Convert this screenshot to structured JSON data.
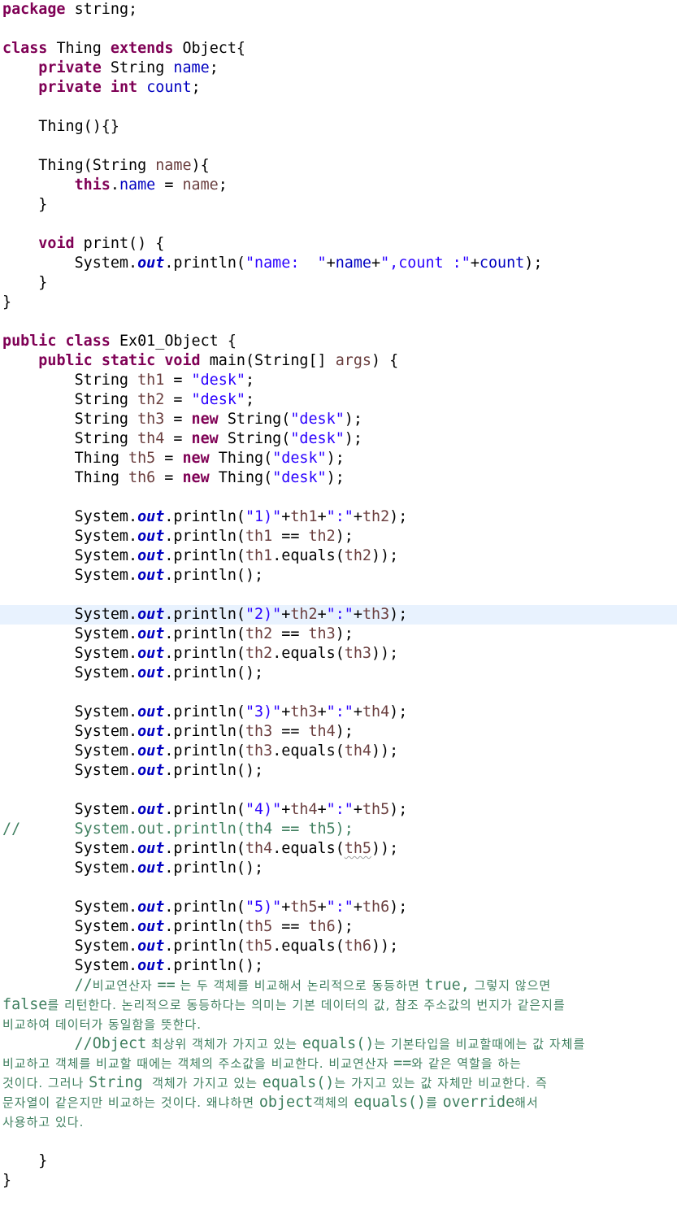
{
  "editor": {
    "highlighted_line_index": 31,
    "colors": {
      "keyword": "#7f0055",
      "string": "#2a00ff",
      "field": "#0000c0",
      "variable": "#6a3e3e",
      "comment": "#3f7f5f",
      "line_highlight": "#e8f2fe"
    },
    "lines": [
      [
        {
          "t": "package",
          "c": "kw"
        },
        {
          "t": " string;"
        }
      ],
      [],
      [
        {
          "t": "class",
          "c": "kw"
        },
        {
          "t": " Thing "
        },
        {
          "t": "extends",
          "c": "kw"
        },
        {
          "t": " Object{"
        }
      ],
      [
        {
          "t": "    "
        },
        {
          "t": "private",
          "c": "kw"
        },
        {
          "t": " String "
        },
        {
          "t": "name",
          "c": "fld"
        },
        {
          "t": ";"
        }
      ],
      [
        {
          "t": "    "
        },
        {
          "t": "private",
          "c": "kw"
        },
        {
          "t": " "
        },
        {
          "t": "int",
          "c": "kw"
        },
        {
          "t": " "
        },
        {
          "t": "count",
          "c": "fld"
        },
        {
          "t": ";"
        }
      ],
      [],
      [
        {
          "t": "    Thing(){}"
        }
      ],
      [],
      [
        {
          "t": "    Thing(String "
        },
        {
          "t": "name",
          "c": "var"
        },
        {
          "t": "){"
        }
      ],
      [
        {
          "t": "        "
        },
        {
          "t": "this",
          "c": "kw"
        },
        {
          "t": "."
        },
        {
          "t": "name",
          "c": "fld"
        },
        {
          "t": " = "
        },
        {
          "t": "name",
          "c": "var"
        },
        {
          "t": ";"
        }
      ],
      [
        {
          "t": "    }"
        }
      ],
      [],
      [
        {
          "t": "    "
        },
        {
          "t": "void",
          "c": "kw"
        },
        {
          "t": " print() {"
        }
      ],
      [
        {
          "t": "        System."
        },
        {
          "t": "out",
          "c": "sfld"
        },
        {
          "t": ".println("
        },
        {
          "t": "\"name:  \"",
          "c": "str"
        },
        {
          "t": "+"
        },
        {
          "t": "name",
          "c": "fld"
        },
        {
          "t": "+"
        },
        {
          "t": "\",count :\"",
          "c": "str"
        },
        {
          "t": "+"
        },
        {
          "t": "count",
          "c": "fld"
        },
        {
          "t": ");"
        }
      ],
      [
        {
          "t": "    }"
        }
      ],
      [
        {
          "t": "}"
        }
      ],
      [],
      [
        {
          "t": "public",
          "c": "kw"
        },
        {
          "t": " "
        },
        {
          "t": "class",
          "c": "kw"
        },
        {
          "t": " Ex01_Object {"
        }
      ],
      [
        {
          "t": "    "
        },
        {
          "t": "public",
          "c": "kw"
        },
        {
          "t": " "
        },
        {
          "t": "static",
          "c": "kw"
        },
        {
          "t": " "
        },
        {
          "t": "void",
          "c": "kw"
        },
        {
          "t": " main(String[] "
        },
        {
          "t": "args",
          "c": "var"
        },
        {
          "t": ") {"
        }
      ],
      [
        {
          "t": "        String "
        },
        {
          "t": "th1",
          "c": "var"
        },
        {
          "t": " = "
        },
        {
          "t": "\"desk\"",
          "c": "str"
        },
        {
          "t": ";"
        }
      ],
      [
        {
          "t": "        String "
        },
        {
          "t": "th2",
          "c": "var"
        },
        {
          "t": " = "
        },
        {
          "t": "\"desk\"",
          "c": "str"
        },
        {
          "t": ";"
        }
      ],
      [
        {
          "t": "        String "
        },
        {
          "t": "th3",
          "c": "var"
        },
        {
          "t": " = "
        },
        {
          "t": "new",
          "c": "kw"
        },
        {
          "t": " String("
        },
        {
          "t": "\"desk\"",
          "c": "str"
        },
        {
          "t": ");"
        }
      ],
      [
        {
          "t": "        String "
        },
        {
          "t": "th4",
          "c": "var"
        },
        {
          "t": " = "
        },
        {
          "t": "new",
          "c": "kw"
        },
        {
          "t": " String("
        },
        {
          "t": "\"desk\"",
          "c": "str"
        },
        {
          "t": ");"
        }
      ],
      [
        {
          "t": "        Thing "
        },
        {
          "t": "th5",
          "c": "var"
        },
        {
          "t": " = "
        },
        {
          "t": "new",
          "c": "kw"
        },
        {
          "t": " Thing("
        },
        {
          "t": "\"desk\"",
          "c": "str"
        },
        {
          "t": ");"
        }
      ],
      [
        {
          "t": "        Thing "
        },
        {
          "t": "th6",
          "c": "var"
        },
        {
          "t": " = "
        },
        {
          "t": "new",
          "c": "kw"
        },
        {
          "t": " Thing("
        },
        {
          "t": "\"desk\"",
          "c": "str"
        },
        {
          "t": ");"
        }
      ],
      [],
      [
        {
          "t": "        System."
        },
        {
          "t": "out",
          "c": "sfld"
        },
        {
          "t": ".println("
        },
        {
          "t": "\"1)\"",
          "c": "str"
        },
        {
          "t": "+"
        },
        {
          "t": "th1",
          "c": "var"
        },
        {
          "t": "+"
        },
        {
          "t": "\":\"",
          "c": "str"
        },
        {
          "t": "+"
        },
        {
          "t": "th2",
          "c": "var"
        },
        {
          "t": ");"
        }
      ],
      [
        {
          "t": "        System."
        },
        {
          "t": "out",
          "c": "sfld"
        },
        {
          "t": ".println("
        },
        {
          "t": "th1",
          "c": "var"
        },
        {
          "t": " == "
        },
        {
          "t": "th2",
          "c": "var"
        },
        {
          "t": ");"
        }
      ],
      [
        {
          "t": "        System."
        },
        {
          "t": "out",
          "c": "sfld"
        },
        {
          "t": ".println("
        },
        {
          "t": "th1",
          "c": "var"
        },
        {
          "t": ".equals("
        },
        {
          "t": "th2",
          "c": "var"
        },
        {
          "t": "));"
        }
      ],
      [
        {
          "t": "        System."
        },
        {
          "t": "out",
          "c": "sfld"
        },
        {
          "t": ".println();"
        }
      ],
      [],
      [
        {
          "t": "        System."
        },
        {
          "t": "out",
          "c": "sfld"
        },
        {
          "t": ".println("
        },
        {
          "t": "\"2)\"",
          "c": "str"
        },
        {
          "t": "+"
        },
        {
          "t": "th2",
          "c": "var"
        },
        {
          "t": "+"
        },
        {
          "t": "\":\"",
          "c": "str"
        },
        {
          "t": "+"
        },
        {
          "t": "th3",
          "c": "var"
        },
        {
          "t": ");"
        }
      ],
      [
        {
          "t": "        System."
        },
        {
          "t": "out",
          "c": "sfld"
        },
        {
          "t": ".println("
        },
        {
          "t": "th2",
          "c": "var"
        },
        {
          "t": " == "
        },
        {
          "t": "th3",
          "c": "var"
        },
        {
          "t": ");"
        }
      ],
      [
        {
          "t": "        System."
        },
        {
          "t": "out",
          "c": "sfld"
        },
        {
          "t": ".println("
        },
        {
          "t": "th2",
          "c": "var"
        },
        {
          "t": ".equals("
        },
        {
          "t": "th3",
          "c": "var"
        },
        {
          "t": "));"
        }
      ],
      [
        {
          "t": "        System."
        },
        {
          "t": "out",
          "c": "sfld"
        },
        {
          "t": ".println();"
        }
      ],
      [],
      [
        {
          "t": "        System."
        },
        {
          "t": "out",
          "c": "sfld"
        },
        {
          "t": ".println("
        },
        {
          "t": "\"3)\"",
          "c": "str"
        },
        {
          "t": "+"
        },
        {
          "t": "th3",
          "c": "var"
        },
        {
          "t": "+"
        },
        {
          "t": "\":\"",
          "c": "str"
        },
        {
          "t": "+"
        },
        {
          "t": "th4",
          "c": "var"
        },
        {
          "t": ");"
        }
      ],
      [
        {
          "t": "        System."
        },
        {
          "t": "out",
          "c": "sfld"
        },
        {
          "t": ".println("
        },
        {
          "t": "th3",
          "c": "var"
        },
        {
          "t": " == "
        },
        {
          "t": "th4",
          "c": "var"
        },
        {
          "t": ");"
        }
      ],
      [
        {
          "t": "        System."
        },
        {
          "t": "out",
          "c": "sfld"
        },
        {
          "t": ".println("
        },
        {
          "t": "th3",
          "c": "var"
        },
        {
          "t": ".equals("
        },
        {
          "t": "th4",
          "c": "var"
        },
        {
          "t": "));"
        }
      ],
      [
        {
          "t": "        System."
        },
        {
          "t": "out",
          "c": "sfld"
        },
        {
          "t": ".println();"
        }
      ],
      [],
      [
        {
          "t": "        System."
        },
        {
          "t": "out",
          "c": "sfld"
        },
        {
          "t": ".println("
        },
        {
          "t": "\"4)\"",
          "c": "str"
        },
        {
          "t": "+"
        },
        {
          "t": "th4",
          "c": "var"
        },
        {
          "t": "+"
        },
        {
          "t": "\":\"",
          "c": "str"
        },
        {
          "t": "+"
        },
        {
          "t": "th5",
          "c": "var"
        },
        {
          "t": ");"
        }
      ],
      [
        {
          "t": "//      System.out.println(th4 == th5);",
          "c": "cmt"
        }
      ],
      [
        {
          "t": "        System."
        },
        {
          "t": "out",
          "c": "sfld"
        },
        {
          "t": ".println("
        },
        {
          "t": "th4",
          "c": "var"
        },
        {
          "t": ".equals("
        },
        {
          "t": "th5",
          "c": "var squig"
        },
        {
          "t": "));"
        }
      ],
      [
        {
          "t": "        System."
        },
        {
          "t": "out",
          "c": "sfld"
        },
        {
          "t": ".println();"
        }
      ],
      [],
      [
        {
          "t": "        System."
        },
        {
          "t": "out",
          "c": "sfld"
        },
        {
          "t": ".println("
        },
        {
          "t": "\"5)\"",
          "c": "str"
        },
        {
          "t": "+"
        },
        {
          "t": "th5",
          "c": "var"
        },
        {
          "t": "+"
        },
        {
          "t": "\":\"",
          "c": "str"
        },
        {
          "t": "+"
        },
        {
          "t": "th6",
          "c": "var"
        },
        {
          "t": ");"
        }
      ],
      [
        {
          "t": "        System."
        },
        {
          "t": "out",
          "c": "sfld"
        },
        {
          "t": ".println("
        },
        {
          "t": "th5",
          "c": "var"
        },
        {
          "t": " == "
        },
        {
          "t": "th6",
          "c": "var"
        },
        {
          "t": ");"
        }
      ],
      [
        {
          "t": "        System."
        },
        {
          "t": "out",
          "c": "sfld"
        },
        {
          "t": ".println("
        },
        {
          "t": "th5",
          "c": "var"
        },
        {
          "t": ".equals("
        },
        {
          "t": "th6",
          "c": "var"
        },
        {
          "t": "));"
        }
      ],
      [
        {
          "t": "        System."
        },
        {
          "t": "out",
          "c": "sfld"
        },
        {
          "t": ".println();"
        }
      ],
      [
        {
          "t": "        //",
          "c": "cmt"
        },
        {
          "t": "비교연산자 ",
          "c": "cmt kor"
        },
        {
          "t": "==",
          "c": "cmt"
        },
        {
          "t": " 는 두 객체를 비교해서 논리적으로 동등하면 ",
          "c": "cmt kor"
        },
        {
          "t": "true,",
          "c": "cmt"
        },
        {
          "t": " 그렇지 않으면",
          "c": "cmt kor"
        }
      ],
      [
        {
          "t": "false",
          "c": "cmt"
        },
        {
          "t": "를 리턴한다. 논리적으로 동등하다는 의미는 기본 데이터의 값, 참조 주소값의 번지가 같은지를",
          "c": "cmt kor"
        }
      ],
      [
        {
          "t": "비교하여 데이터가 동일함을 뜻한다.",
          "c": "cmt kor"
        }
      ],
      [
        {
          "t": "        //Object",
          "c": "cmt"
        },
        {
          "t": " 최상위 객체가 가지고 있는 ",
          "c": "cmt kor"
        },
        {
          "t": "equals()",
          "c": "cmt"
        },
        {
          "t": "는 기본타입을 비교할때에는 값 자체를",
          "c": "cmt kor"
        }
      ],
      [
        {
          "t": "비교하고 객체를 비교할 때에는 객체의 주소값을 비교한다. 비교연산자 ",
          "c": "cmt kor"
        },
        {
          "t": "==",
          "c": "cmt"
        },
        {
          "t": "와 같은 역할을 하는",
          "c": "cmt kor"
        }
      ],
      [
        {
          "t": "것이다. 그러나 ",
          "c": "cmt kor"
        },
        {
          "t": "String",
          "c": "cmt"
        },
        {
          "t": "  객체가 가지고 있는 ",
          "c": "cmt kor"
        },
        {
          "t": "equals()",
          "c": "cmt"
        },
        {
          "t": "는 가지고 있는 값 자체만 비교한다. 즉",
          "c": "cmt kor"
        }
      ],
      [
        {
          "t": "문자열이 같은지만 비교하는 것이다. 왜냐하면 ",
          "c": "cmt kor"
        },
        {
          "t": "object",
          "c": "cmt"
        },
        {
          "t": "객체의 ",
          "c": "cmt kor"
        },
        {
          "t": "equals()",
          "c": "cmt"
        },
        {
          "t": "를 ",
          "c": "cmt kor"
        },
        {
          "t": "override",
          "c": "cmt"
        },
        {
          "t": "해서",
          "c": "cmt kor"
        }
      ],
      [
        {
          "t": "사용하고 있다.",
          "c": "cmt kor"
        }
      ],
      [],
      [
        {
          "t": "    }"
        }
      ],
      [
        {
          "t": "}"
        }
      ]
    ]
  }
}
